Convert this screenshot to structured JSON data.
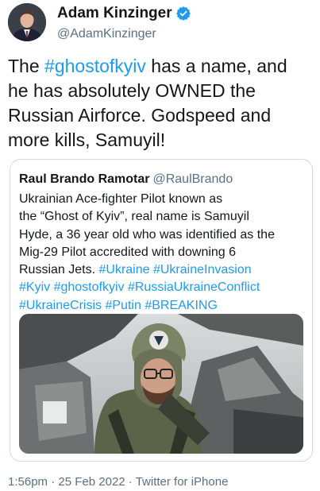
{
  "author": {
    "display_name": "Adam Kinzinger",
    "handle": "@AdamKinzinger",
    "verified_icon": "verified-badge-icon",
    "verified_color": "#1d9bf0"
  },
  "tweet": {
    "lines": [
      [
        {
          "t": "The ",
          "h": false
        },
        {
          "t": "#ghostofkyiv",
          "h": true
        },
        {
          "t": " has a name, and",
          "h": false
        }
      ],
      [
        {
          "t": "he has absolutely OWNED the",
          "h": false
        }
      ],
      [
        {
          "t": "Russian Airforce.  Godspeed and",
          "h": false
        }
      ],
      [
        {
          "t": "more kills, Samuyil!",
          "h": false
        }
      ]
    ]
  },
  "quote": {
    "display_name": "Raul Brando Ramotar",
    "handle": "@RaulBrando",
    "lines": [
      [
        {
          "t": "Ukrainian Ace-fighter Pilot known as",
          "h": false
        }
      ],
      [
        {
          "t": "the “Ghost of Kyiv”, real name is Samuyil",
          "h": false
        }
      ],
      [
        {
          "t": "Hyde, a 36 year old who was identified as the",
          "h": false
        }
      ],
      [
        {
          "t": "Mig-29 Pilot accredited with downing 6",
          "h": false
        }
      ],
      [
        {
          "t": "Russian Jets. ",
          "h": false
        },
        {
          "t": "#Ukraine",
          "h": true
        },
        {
          "t": " ",
          "h": false
        },
        {
          "t": "#UkraineInvasion",
          "h": true
        }
      ],
      [
        {
          "t": "#Kyiv",
          "h": true
        },
        {
          "t": " ",
          "h": false
        },
        {
          "t": "#ghostofkyiv",
          "h": true
        },
        {
          "t": " ",
          "h": false
        },
        {
          "t": "#RussiaUkraineConflict",
          "h": true
        }
      ],
      [
        {
          "t": "#UkraineCrisis",
          "h": true
        },
        {
          "t": " ",
          "h": false
        },
        {
          "t": "#Putin",
          "h": true
        },
        {
          "t": " ",
          "h": false
        },
        {
          "t": "#BREAKING",
          "h": true
        }
      ]
    ]
  },
  "meta": {
    "time": "1:56pm",
    "date": "25 Feb 2022",
    "source": "Twitter for iPhone",
    "separator": " · "
  },
  "colors": {
    "hashtag": "#1d9bf0",
    "secondary_text": "#5b7083",
    "border": "#cfd9de"
  }
}
